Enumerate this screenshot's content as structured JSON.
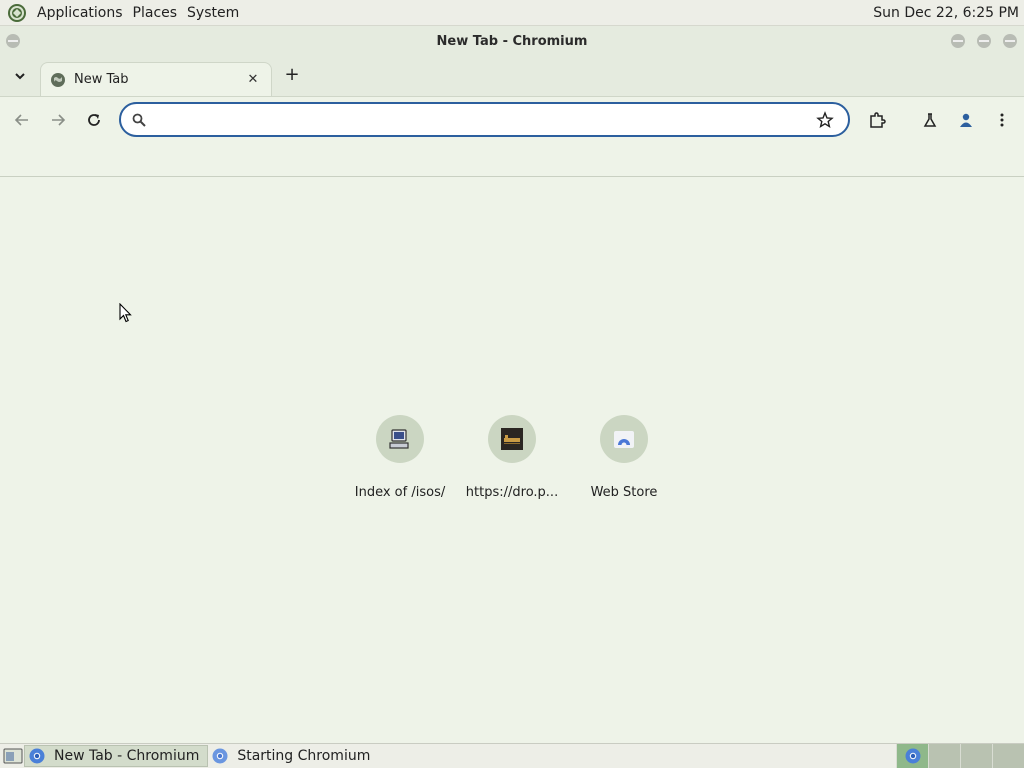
{
  "panel": {
    "menus": [
      "Applications",
      "Places",
      "System"
    ],
    "clock": "Sun Dec 22,  6:25 PM"
  },
  "window": {
    "title": "New Tab - Chromium"
  },
  "tabs": [
    {
      "label": "New Tab",
      "icon": "globe-icon"
    }
  ],
  "toolbar": {
    "omnibox_value": "",
    "icons": [
      "back-arrow-icon",
      "forward-arrow-icon",
      "reload-icon",
      "bookmark-star-icon",
      "extensions-icon",
      "labs-flask-icon",
      "profile-icon",
      "menu-icon"
    ]
  },
  "shortcuts": [
    {
      "label": "Index of /isos/",
      "icon": "computer-icon"
    },
    {
      "label": "https://dro.p...",
      "icon": "dark-thumbnail-icon"
    },
    {
      "label": "Web Store",
      "icon": "web-store-icon"
    }
  ],
  "taskbar": {
    "tasks": [
      {
        "label": "New Tab - Chromium",
        "active": true
      },
      {
        "label": "Starting Chromium",
        "active": false
      }
    ]
  },
  "colors": {
    "accent": "#2c5f9e",
    "background": "#eef3e8",
    "chrome": "#e5ebdf"
  }
}
